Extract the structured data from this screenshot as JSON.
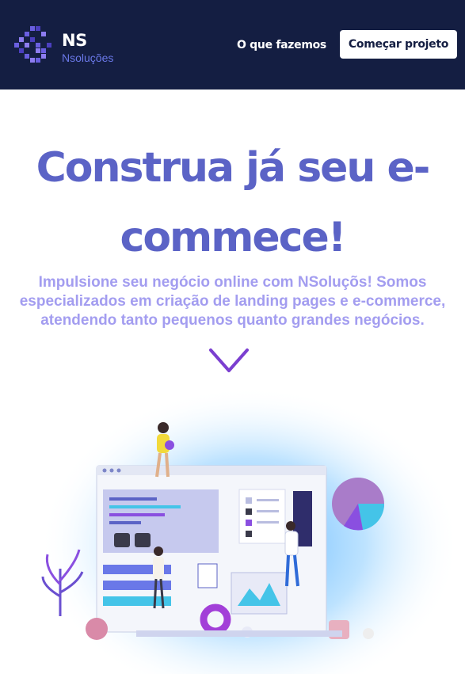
{
  "header": {
    "brand_name": "NS",
    "brand_sub": "Nsoluções",
    "nav_link": "O que fazemos",
    "cta_label": "Começar projeto"
  },
  "hero": {
    "title": "Construa já seu e-commece!",
    "text": "Impulsione seu negócio online com NSoluçõs! Somos especializados em criação de landing pages e e-commerce, atendendo tanto pequenos quanto grandes negócios."
  },
  "colors": {
    "navbar_bg": "#141e42",
    "title": "#5b63c6",
    "subtitle": "#a39df0",
    "accent": "#6a78e8",
    "chevron": "#7b3fd0"
  },
  "icons": {
    "logo": "ns-logo-icon",
    "scroll_down": "chevron-down-icon"
  }
}
